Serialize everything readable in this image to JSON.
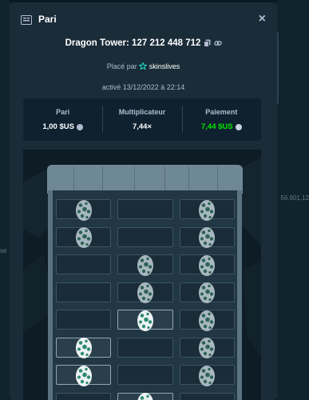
{
  "backdrop": {
    "number": "56.901,12",
    "text": "se"
  },
  "modal": {
    "header": {
      "title": "Pari",
      "icon": "receipt-icon",
      "close_icon": "close-icon",
      "close_label": "×"
    },
    "game_title": "Dragon Tower: 127 212 448 712",
    "placed_prefix": "Placé par",
    "username": "skinslives",
    "activated": "activé 13/12/2022 à 22:14",
    "stats": [
      {
        "label": "Pari",
        "value": "1,00 $US",
        "coin": true
      },
      {
        "label": "Multiplicateur",
        "value": "7,44×",
        "coin": false
      },
      {
        "label": "Paiement",
        "value": "7,44 $US",
        "coin": true,
        "color": "#00e701"
      }
    ]
  },
  "tower": {
    "rows": [
      [
        {
          "egg": "dim",
          "picked": false
        },
        {
          "egg": null,
          "picked": false
        },
        {
          "egg": "dim",
          "picked": false
        }
      ],
      [
        {
          "egg": "dim",
          "picked": false
        },
        {
          "egg": null,
          "picked": false
        },
        {
          "egg": "dim",
          "picked": false
        }
      ],
      [
        {
          "egg": null,
          "picked": false
        },
        {
          "egg": "dim",
          "picked": false
        },
        {
          "egg": "dim",
          "picked": false
        }
      ],
      [
        {
          "egg": null,
          "picked": false
        },
        {
          "egg": "dim",
          "picked": false
        },
        {
          "egg": "dim",
          "picked": false
        }
      ],
      [
        {
          "egg": null,
          "picked": false
        },
        {
          "egg": "bright",
          "picked": true
        },
        {
          "egg": "dim",
          "picked": false
        }
      ],
      [
        {
          "egg": "bright",
          "picked": true
        },
        {
          "egg": null,
          "picked": false
        },
        {
          "egg": "dim",
          "picked": false
        }
      ],
      [
        {
          "egg": "bright",
          "picked": true
        },
        {
          "egg": null,
          "picked": false
        },
        {
          "egg": "dim",
          "picked": false
        }
      ],
      [
        {
          "egg": null,
          "picked": false
        },
        {
          "egg": "bright",
          "picked": true
        },
        {
          "egg": null,
          "picked": false
        }
      ]
    ]
  }
}
